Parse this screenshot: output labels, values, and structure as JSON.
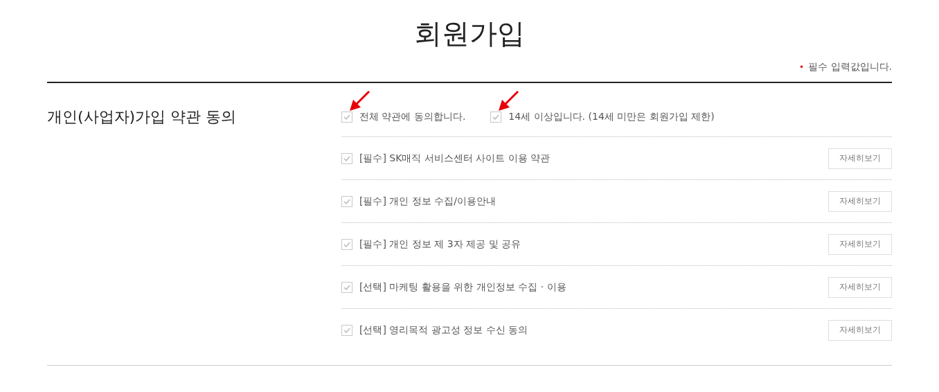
{
  "title": "회원가입",
  "required_note": {
    "mark": "•",
    "text": "필수 입력값입니다."
  },
  "section": {
    "heading": "개인(사업자)가입 약관 동의",
    "top_options": [
      {
        "label": "전체 약관에 동의합니다.",
        "checked": true
      },
      {
        "label": "14세 이상입니다. (14세 미만은 회원가입 제한)",
        "checked": true
      }
    ],
    "terms": [
      {
        "label": "[필수] SK매직 서비스센터 사이트 이용 약관",
        "checked": true,
        "button": "자세히보기"
      },
      {
        "label": "[필수] 개인 정보 수집/이용안내",
        "checked": true,
        "button": "자세히보기"
      },
      {
        "label": "[필수] 개인 정보 제 3자 제공 및 공유",
        "checked": true,
        "button": "자세히보기"
      },
      {
        "label": "[선택] 마케팅 활용을 위한 개인정보 수집 · 이용",
        "checked": true,
        "button": "자세히보기"
      },
      {
        "label": "[선택] 영리목적 광고성 정보 수신 동의",
        "checked": true,
        "button": "자세히보기"
      }
    ]
  }
}
